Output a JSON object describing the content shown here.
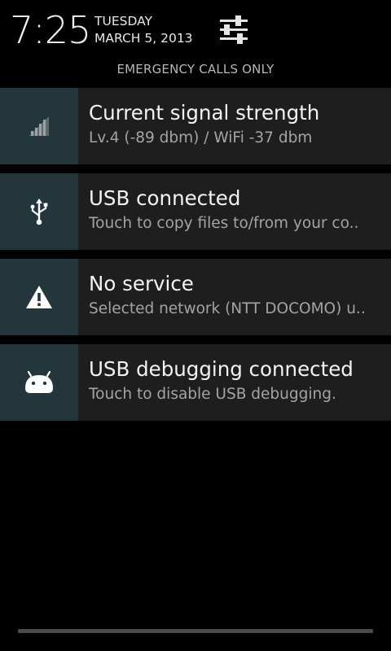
{
  "header": {
    "time": "7:25",
    "day": "TUESDAY",
    "date": "MARCH 5, 2013",
    "settings_icon": "settings-sliders-icon"
  },
  "status": {
    "emergency_text": "EMERGENCY CALLS ONLY"
  },
  "notifications": [
    {
      "icon": "signal-strength-icon",
      "title": "Current signal strength",
      "text": "Lv.4 (-89 dbm) / WiFi -37 dbm"
    },
    {
      "icon": "usb-icon",
      "title": "USB connected",
      "text": "Touch to copy files to/from your co.."
    },
    {
      "icon": "warning-icon",
      "title": "No service",
      "text": "Selected network (NTT DOCOMO) u.."
    },
    {
      "icon": "android-icon",
      "title": "USB debugging connected",
      "text": "Touch to disable USB debugging."
    }
  ],
  "colors": {
    "background": "#000000",
    "notification_bg": "#1e1e1e",
    "icon_bg": "#23363c",
    "title_text": "#f3f3f3",
    "body_text": "#a4a4a4"
  }
}
